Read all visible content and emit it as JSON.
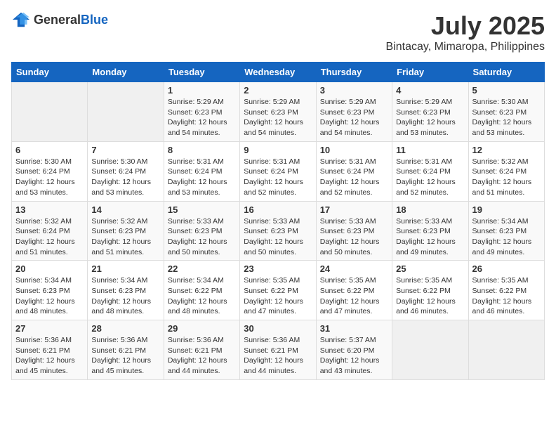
{
  "header": {
    "logo_general": "General",
    "logo_blue": "Blue",
    "month": "July 2025",
    "location": "Bintacay, Mimaropa, Philippines"
  },
  "weekdays": [
    "Sunday",
    "Monday",
    "Tuesday",
    "Wednesday",
    "Thursday",
    "Friday",
    "Saturday"
  ],
  "weeks": [
    [
      {
        "day": "",
        "empty": true
      },
      {
        "day": "",
        "empty": true
      },
      {
        "day": "1",
        "sunrise": "Sunrise: 5:29 AM",
        "sunset": "Sunset: 6:23 PM",
        "daylight": "Daylight: 12 hours and 54 minutes."
      },
      {
        "day": "2",
        "sunrise": "Sunrise: 5:29 AM",
        "sunset": "Sunset: 6:23 PM",
        "daylight": "Daylight: 12 hours and 54 minutes."
      },
      {
        "day": "3",
        "sunrise": "Sunrise: 5:29 AM",
        "sunset": "Sunset: 6:23 PM",
        "daylight": "Daylight: 12 hours and 54 minutes."
      },
      {
        "day": "4",
        "sunrise": "Sunrise: 5:29 AM",
        "sunset": "Sunset: 6:23 PM",
        "daylight": "Daylight: 12 hours and 53 minutes."
      },
      {
        "day": "5",
        "sunrise": "Sunrise: 5:30 AM",
        "sunset": "Sunset: 6:23 PM",
        "daylight": "Daylight: 12 hours and 53 minutes."
      }
    ],
    [
      {
        "day": "6",
        "sunrise": "Sunrise: 5:30 AM",
        "sunset": "Sunset: 6:24 PM",
        "daylight": "Daylight: 12 hours and 53 minutes."
      },
      {
        "day": "7",
        "sunrise": "Sunrise: 5:30 AM",
        "sunset": "Sunset: 6:24 PM",
        "daylight": "Daylight: 12 hours and 53 minutes."
      },
      {
        "day": "8",
        "sunrise": "Sunrise: 5:31 AM",
        "sunset": "Sunset: 6:24 PM",
        "daylight": "Daylight: 12 hours and 53 minutes."
      },
      {
        "day": "9",
        "sunrise": "Sunrise: 5:31 AM",
        "sunset": "Sunset: 6:24 PM",
        "daylight": "Daylight: 12 hours and 52 minutes."
      },
      {
        "day": "10",
        "sunrise": "Sunrise: 5:31 AM",
        "sunset": "Sunset: 6:24 PM",
        "daylight": "Daylight: 12 hours and 52 minutes."
      },
      {
        "day": "11",
        "sunrise": "Sunrise: 5:31 AM",
        "sunset": "Sunset: 6:24 PM",
        "daylight": "Daylight: 12 hours and 52 minutes."
      },
      {
        "day": "12",
        "sunrise": "Sunrise: 5:32 AM",
        "sunset": "Sunset: 6:24 PM",
        "daylight": "Daylight: 12 hours and 51 minutes."
      }
    ],
    [
      {
        "day": "13",
        "sunrise": "Sunrise: 5:32 AM",
        "sunset": "Sunset: 6:24 PM",
        "daylight": "Daylight: 12 hours and 51 minutes."
      },
      {
        "day": "14",
        "sunrise": "Sunrise: 5:32 AM",
        "sunset": "Sunset: 6:23 PM",
        "daylight": "Daylight: 12 hours and 51 minutes."
      },
      {
        "day": "15",
        "sunrise": "Sunrise: 5:33 AM",
        "sunset": "Sunset: 6:23 PM",
        "daylight": "Daylight: 12 hours and 50 minutes."
      },
      {
        "day": "16",
        "sunrise": "Sunrise: 5:33 AM",
        "sunset": "Sunset: 6:23 PM",
        "daylight": "Daylight: 12 hours and 50 minutes."
      },
      {
        "day": "17",
        "sunrise": "Sunrise: 5:33 AM",
        "sunset": "Sunset: 6:23 PM",
        "daylight": "Daylight: 12 hours and 50 minutes."
      },
      {
        "day": "18",
        "sunrise": "Sunrise: 5:33 AM",
        "sunset": "Sunset: 6:23 PM",
        "daylight": "Daylight: 12 hours and 49 minutes."
      },
      {
        "day": "19",
        "sunrise": "Sunrise: 5:34 AM",
        "sunset": "Sunset: 6:23 PM",
        "daylight": "Daylight: 12 hours and 49 minutes."
      }
    ],
    [
      {
        "day": "20",
        "sunrise": "Sunrise: 5:34 AM",
        "sunset": "Sunset: 6:23 PM",
        "daylight": "Daylight: 12 hours and 48 minutes."
      },
      {
        "day": "21",
        "sunrise": "Sunrise: 5:34 AM",
        "sunset": "Sunset: 6:23 PM",
        "daylight": "Daylight: 12 hours and 48 minutes."
      },
      {
        "day": "22",
        "sunrise": "Sunrise: 5:34 AM",
        "sunset": "Sunset: 6:22 PM",
        "daylight": "Daylight: 12 hours and 48 minutes."
      },
      {
        "day": "23",
        "sunrise": "Sunrise: 5:35 AM",
        "sunset": "Sunset: 6:22 PM",
        "daylight": "Daylight: 12 hours and 47 minutes."
      },
      {
        "day": "24",
        "sunrise": "Sunrise: 5:35 AM",
        "sunset": "Sunset: 6:22 PM",
        "daylight": "Daylight: 12 hours and 47 minutes."
      },
      {
        "day": "25",
        "sunrise": "Sunrise: 5:35 AM",
        "sunset": "Sunset: 6:22 PM",
        "daylight": "Daylight: 12 hours and 46 minutes."
      },
      {
        "day": "26",
        "sunrise": "Sunrise: 5:35 AM",
        "sunset": "Sunset: 6:22 PM",
        "daylight": "Daylight: 12 hours and 46 minutes."
      }
    ],
    [
      {
        "day": "27",
        "sunrise": "Sunrise: 5:36 AM",
        "sunset": "Sunset: 6:21 PM",
        "daylight": "Daylight: 12 hours and 45 minutes."
      },
      {
        "day": "28",
        "sunrise": "Sunrise: 5:36 AM",
        "sunset": "Sunset: 6:21 PM",
        "daylight": "Daylight: 12 hours and 45 minutes."
      },
      {
        "day": "29",
        "sunrise": "Sunrise: 5:36 AM",
        "sunset": "Sunset: 6:21 PM",
        "daylight": "Daylight: 12 hours and 44 minutes."
      },
      {
        "day": "30",
        "sunrise": "Sunrise: 5:36 AM",
        "sunset": "Sunset: 6:21 PM",
        "daylight": "Daylight: 12 hours and 44 minutes."
      },
      {
        "day": "31",
        "sunrise": "Sunrise: 5:37 AM",
        "sunset": "Sunset: 6:20 PM",
        "daylight": "Daylight: 12 hours and 43 minutes."
      },
      {
        "day": "",
        "empty": true
      },
      {
        "day": "",
        "empty": true
      }
    ]
  ]
}
